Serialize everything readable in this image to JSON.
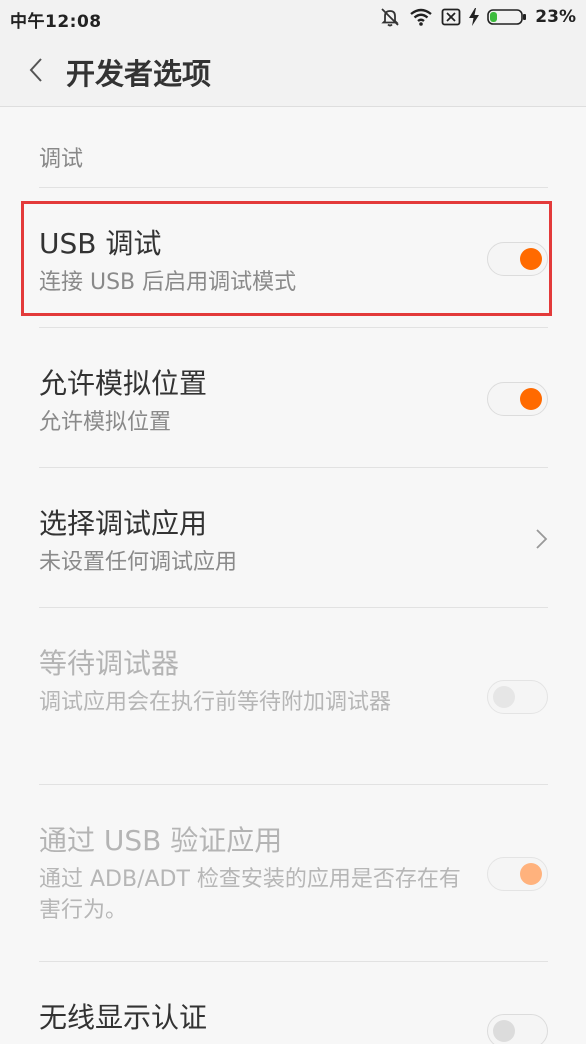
{
  "status_bar": {
    "time": "中午12:08",
    "battery_percent": "23%",
    "battery_level": 0.23,
    "icons": [
      "bell-muted-icon",
      "wifi-icon",
      "sim-none-icon",
      "charging-bolt-icon",
      "battery-icon"
    ]
  },
  "header": {
    "title": "开发者选项",
    "back_icon": "chevron-left-icon"
  },
  "section": {
    "label": "调试"
  },
  "rows": [
    {
      "title": "USB 调试",
      "subtitle": "连接 USB 后启用调试模式",
      "control": "toggle",
      "state": "on",
      "enabled": true
    },
    {
      "title": "允许模拟位置",
      "subtitle": "允许模拟位置",
      "control": "toggle",
      "state": "on",
      "enabled": true
    },
    {
      "title": "选择调试应用",
      "subtitle": "未设置任何调试应用",
      "control": "chevron",
      "enabled": true
    },
    {
      "title": "等待调试器",
      "subtitle": "调试应用会在执行前等待附加调试器",
      "control": "toggle",
      "state": "off",
      "enabled": false
    },
    {
      "title": "通过 USB 验证应用",
      "subtitle": "通过 ADB/ADT 检查安装的应用是否存在有害行为。",
      "control": "toggle",
      "state": "on",
      "enabled": false
    },
    {
      "title": "无线显示认证",
      "subtitle": "",
      "control": "toggle",
      "state": "off",
      "enabled": true
    }
  ],
  "colors": {
    "accent": "#ff6a00",
    "accent_disabled": "#ffb27d",
    "highlight": "#e33a3a",
    "background": "#f7f7f7"
  }
}
